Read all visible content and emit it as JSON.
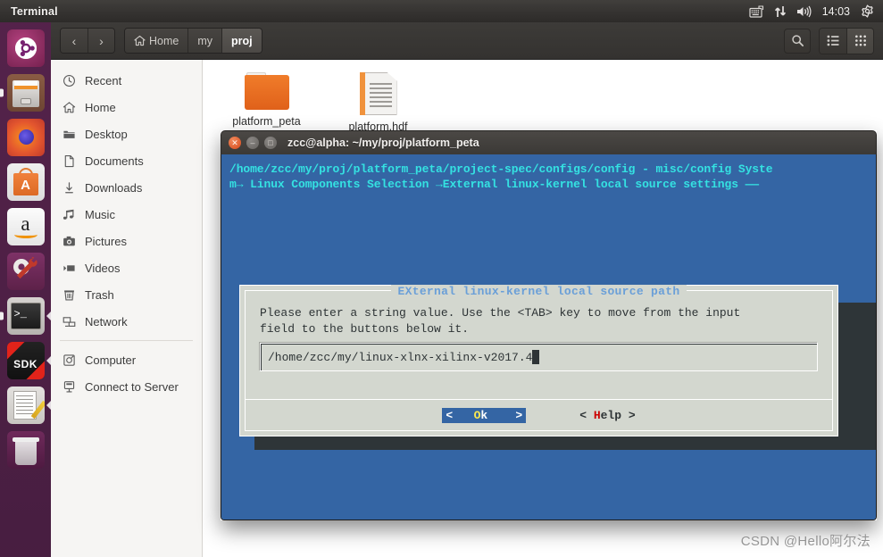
{
  "top_panel": {
    "app_title": "Terminal",
    "clock": "14:03",
    "indicators": [
      "keyboard-icon",
      "network-icon",
      "volume-icon",
      "system-menu-icon"
    ]
  },
  "launcher": {
    "items": [
      {
        "name": "ubuntu-dash",
        "label": "Ubuntu Dash"
      },
      {
        "name": "files",
        "label": "Files"
      },
      {
        "name": "firefox",
        "label": "Firefox"
      },
      {
        "name": "software-center",
        "label": "Ubuntu Software",
        "glyph": "A"
      },
      {
        "name": "amazon",
        "label": "Amazon",
        "glyph": "a"
      },
      {
        "name": "system-settings",
        "label": "System Settings"
      },
      {
        "name": "terminal",
        "label": "Terminal",
        "glyph": ">_"
      },
      {
        "name": "xilinx-sdk",
        "label": "SDK",
        "glyph": "SDK"
      },
      {
        "name": "text-editor",
        "label": "Text Editor"
      },
      {
        "name": "trash",
        "label": "Trash"
      }
    ]
  },
  "file_manager": {
    "nav": {
      "back": "‹",
      "forward": "›"
    },
    "breadcrumbs": [
      {
        "label": "Home",
        "icon": "home-icon",
        "active": false
      },
      {
        "label": "my",
        "icon": "",
        "active": false
      },
      {
        "label": "proj",
        "icon": "",
        "active": true
      }
    ],
    "toolbar": {
      "search": "search-icon",
      "list_view": "list-view-icon",
      "grid_view": "grid-view-icon"
    },
    "sidebar": {
      "items": [
        {
          "label": "Recent",
          "icon": "clock-icon"
        },
        {
          "label": "Home",
          "icon": "home-icon"
        },
        {
          "label": "Desktop",
          "icon": "folder-icon"
        },
        {
          "label": "Documents",
          "icon": "document-icon"
        },
        {
          "label": "Downloads",
          "icon": "download-icon"
        },
        {
          "label": "Music",
          "icon": "music-icon"
        },
        {
          "label": "Pictures",
          "icon": "camera-icon"
        },
        {
          "label": "Videos",
          "icon": "video-icon"
        },
        {
          "label": "Trash",
          "icon": "trash-icon"
        },
        {
          "label": "Network",
          "icon": "network-icon"
        }
      ],
      "items2": [
        {
          "label": "Computer",
          "icon": "computer-icon"
        },
        {
          "label": "Connect to Server",
          "icon": "server-icon"
        }
      ]
    },
    "files": [
      {
        "name": "platform_peta",
        "type": "folder"
      },
      {
        "name": "platform.hdf",
        "type": "file"
      }
    ]
  },
  "terminal": {
    "window_title": "zcc@alpha: ~/my/proj/platform_peta",
    "header_line1": "/home/zcc/my/proj/platform_peta/project-spec/configs/config - misc/config Syste",
    "header_line2": "m→ Linux Components Selection →External linux-kernel local source settings ——",
    "dialog": {
      "title": "EXternal  linux-kernel local source path",
      "message": "Please enter a string value. Use the <TAB> key to move from the input\nfield to the buttons below it.",
      "input_value": "/home/zcc/my/linux-xlnx-xilinx-v2017.4",
      "buttons": [
        {
          "name": "ok-button",
          "prefix": "<   ",
          "accel": "O",
          "rest": "k    >",
          "selected": true
        },
        {
          "name": "help-button",
          "prefix": "< ",
          "accel": "H",
          "rest": "elp >",
          "selected": false
        }
      ]
    }
  },
  "watermark": {
    "text": "CSDN @Hello阿尔法"
  },
  "colors": {
    "terminal_bg": "#3465a4",
    "terminal_fg": "#34e2e2",
    "dialog_bg": "#d3d7cf",
    "accent_selected": "#3465a4",
    "accel_key": "#cc0000",
    "ok_accel": "#fce94f",
    "launcher_bg": "#4e1a44"
  }
}
